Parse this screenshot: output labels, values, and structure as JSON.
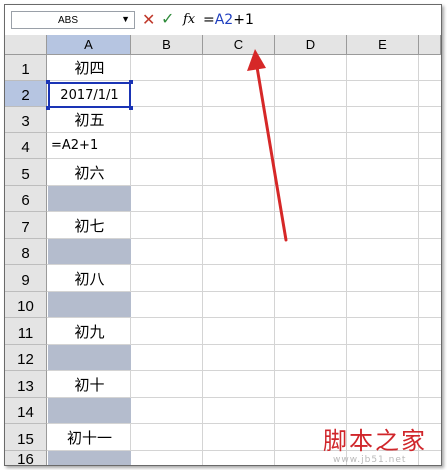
{
  "formula_bar": {
    "name_box": "ABS",
    "cancel_glyph": "✕",
    "enter_glyph": "✓",
    "fx_label": "fx",
    "formula_prefix": "=",
    "formula_ref": "A2",
    "formula_suffix": "+1"
  },
  "columns": [
    "A",
    "B",
    "C",
    "D",
    "E"
  ],
  "rows": [
    "1",
    "2",
    "3",
    "4",
    "5",
    "6",
    "7",
    "8",
    "9",
    "10",
    "11",
    "12",
    "13",
    "14",
    "15",
    "16"
  ],
  "cells": {
    "a1": "初四",
    "a2": "2017/1/1",
    "a3": "初五",
    "a4": "=A2+1",
    "a5": "初六",
    "a7": "初七",
    "a9": "初八",
    "a11": "初九",
    "a13": "初十",
    "a15": "初十一"
  },
  "colors": {
    "selection_border": "#1a34b5",
    "shaded_cell": "#b4bccd",
    "arrow": "#d62828"
  }
}
